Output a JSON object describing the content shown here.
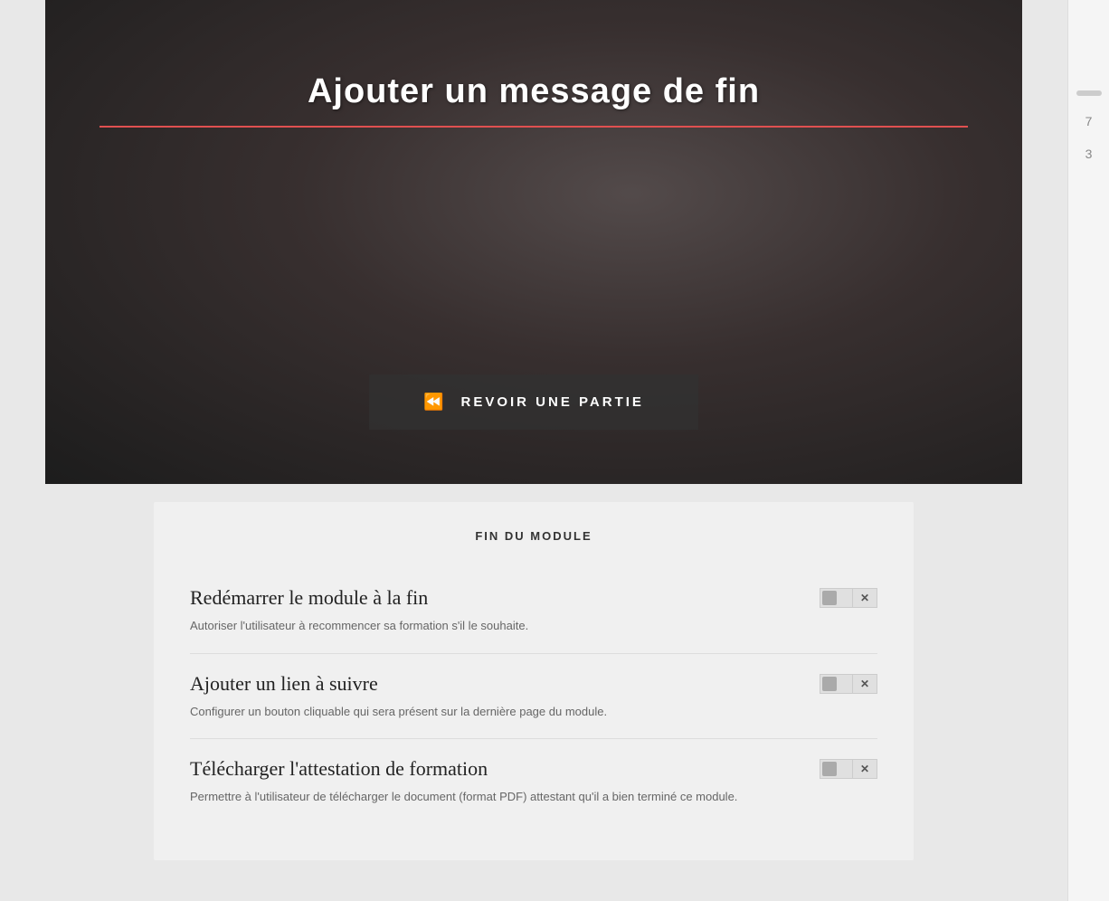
{
  "header": {
    "title": "Ajouter un message de fin"
  },
  "video": {
    "revoir_button_label": "REVOIR UNE PARTIE"
  },
  "panel": {
    "section_title": "FIN DU MODULE",
    "settings": [
      {
        "id": "restart",
        "title": "Redémarrer le module à la fin",
        "description": "Autoriser l'utilisateur à recommencer sa formation s'il le souhaite."
      },
      {
        "id": "link",
        "title": "Ajouter un lien à suivre",
        "description": "Configurer un bouton cliquable qui sera présent sur la dernière page du module."
      },
      {
        "id": "attestation",
        "title": "Télécharger l'attestation de formation",
        "description": "Permettre à l'utilisateur de télécharger le document (format PDF) attestant qu'il a bien terminé ce module."
      }
    ]
  },
  "sidebar": {
    "number1": "7",
    "number2": "3"
  }
}
